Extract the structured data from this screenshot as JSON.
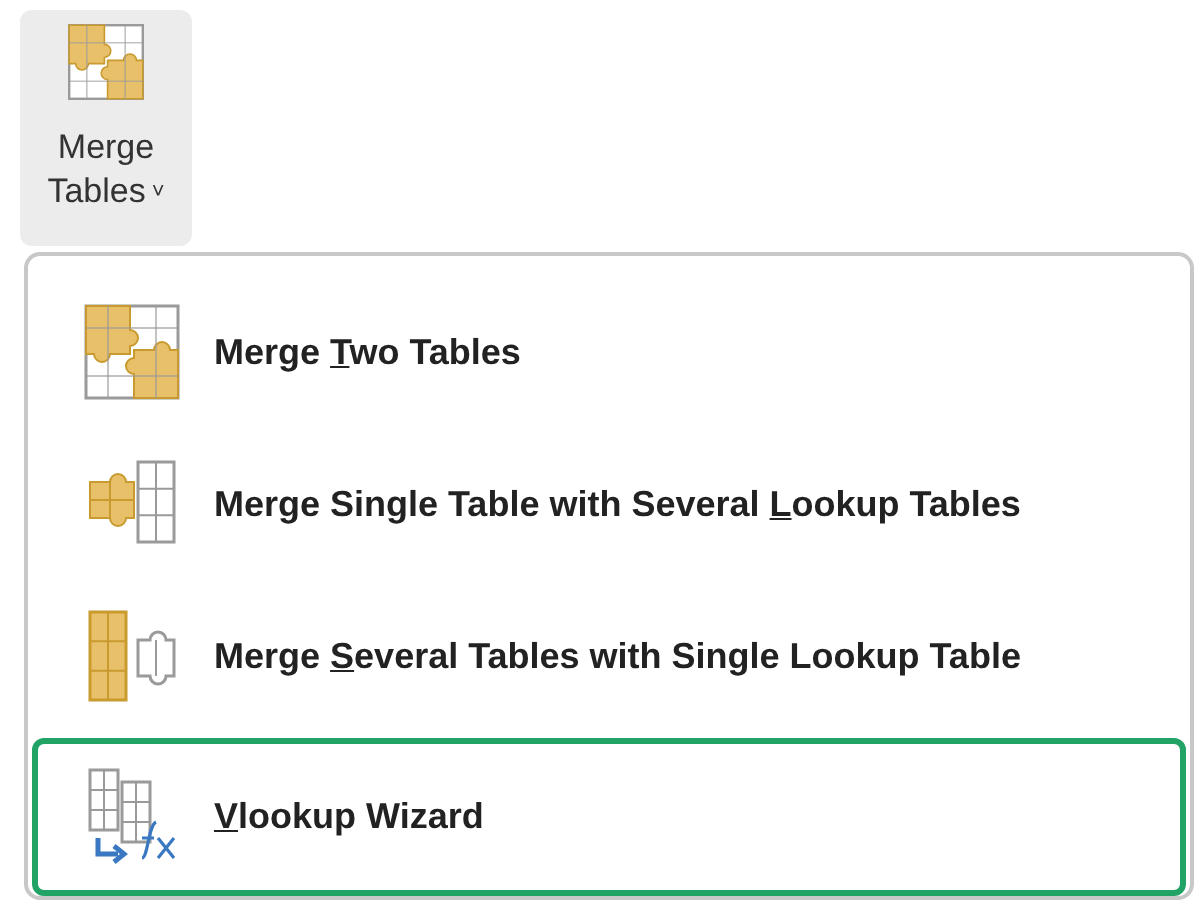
{
  "ribbon_button": {
    "label_line1": "Merge",
    "label_line2": "Tables",
    "caret": "˅"
  },
  "menu": {
    "items": [
      {
        "kind": "two",
        "before": "Merge ",
        "key": "T",
        "after": "wo Tables",
        "selected": false
      },
      {
        "kind": "single-several",
        "before": "Merge Single Table with Several ",
        "key": "L",
        "after": "ookup Tables",
        "selected": false
      },
      {
        "kind": "several-single",
        "before": "Merge ",
        "key": "S",
        "after": "everal Tables with Single Lookup Table",
        "selected": false
      },
      {
        "kind": "vlookup",
        "key": "V",
        "after": "lookup Wizard",
        "selected": true
      }
    ]
  }
}
